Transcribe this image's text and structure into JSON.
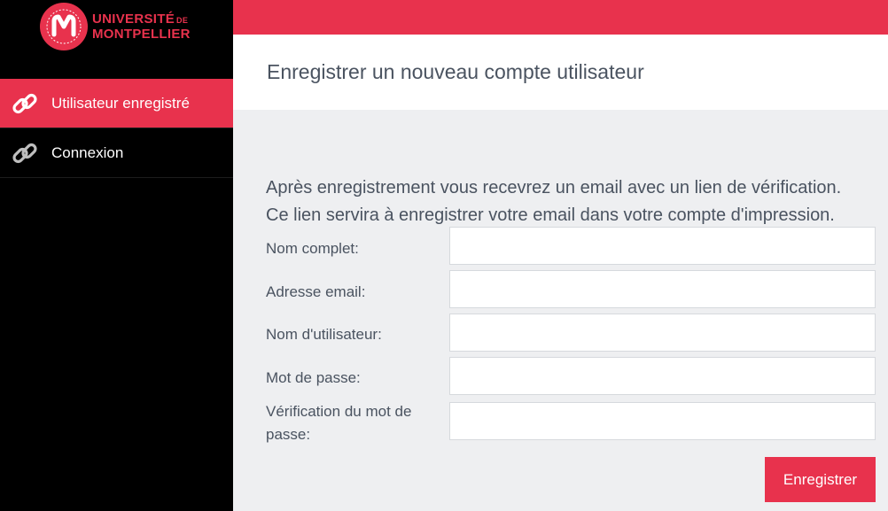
{
  "logo": {
    "line1": "UNIVERSITÉ",
    "line1_suffix": "DE",
    "line2": "MONTPELLIER"
  },
  "sidebar": {
    "items": [
      {
        "label": "Utilisateur enregistré",
        "icon": "link-icon",
        "active": true
      },
      {
        "label": "Connexion",
        "icon": "link-icon",
        "active": false
      }
    ]
  },
  "header": {
    "title": "Enregistrer un nouveau compte utilisateur"
  },
  "intro": {
    "line1": "Après enregistrement vous recevrez un email avec un lien de vérification.",
    "line2": "Ce lien servira à enregistrer votre email dans votre compte d'impression."
  },
  "form": {
    "fullname_label": "Nom complet:",
    "fullname_value": "",
    "email_label": "Adresse email:",
    "email_value": "",
    "username_label": "Nom d'utilisateur:",
    "username_value": "",
    "password_label": "Mot de passe:",
    "password_value": "",
    "password_confirm_label": "Vérification du mot de passe:",
    "password_confirm_value": "",
    "submit_label": "Enregistrer"
  },
  "colors": {
    "accent": "#e8324d",
    "sidebar": "#000000",
    "background": "#eeeff1",
    "text": "#4a5360"
  }
}
